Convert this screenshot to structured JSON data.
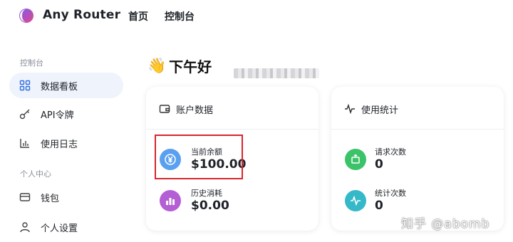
{
  "header": {
    "brand": "Any Router",
    "nav": [
      {
        "label": "首页"
      },
      {
        "label": "控制台"
      }
    ]
  },
  "sidebar": {
    "section1": "控制台",
    "items1": [
      {
        "label": "数据看板",
        "icon": "grid-icon",
        "active": true
      },
      {
        "label": "API令牌",
        "icon": "key-icon"
      },
      {
        "label": "使用日志",
        "icon": "bar-chart-icon"
      }
    ],
    "section2": "个人中心",
    "items2": [
      {
        "label": "钱包",
        "icon": "wallet-icon"
      },
      {
        "label": "个人设置",
        "icon": "user-icon"
      }
    ]
  },
  "main": {
    "greeting_emoji": "👋",
    "greeting": "下午好",
    "account_card": {
      "title": "账户数据",
      "stats": [
        {
          "label": "当前余额",
          "value": "$100.00",
          "icon": "yen-icon",
          "color": "#5aa0f0"
        },
        {
          "label": "历史消耗",
          "value": "$0.00",
          "icon": "bar-chart-icon",
          "color": "#b45fd4"
        }
      ]
    },
    "usage_card": {
      "title": "使用统计",
      "stats": [
        {
          "label": "请求次数",
          "value": "0",
          "icon": "send-icon",
          "color": "#3cc36a"
        },
        {
          "label": "统计次数",
          "value": "0",
          "icon": "pulse-icon",
          "color": "#35b8c8"
        }
      ]
    }
  },
  "watermark": "知乎 @abomb",
  "colors": {
    "accent": "#2f6fe0",
    "highlight_border": "#d8262b"
  }
}
